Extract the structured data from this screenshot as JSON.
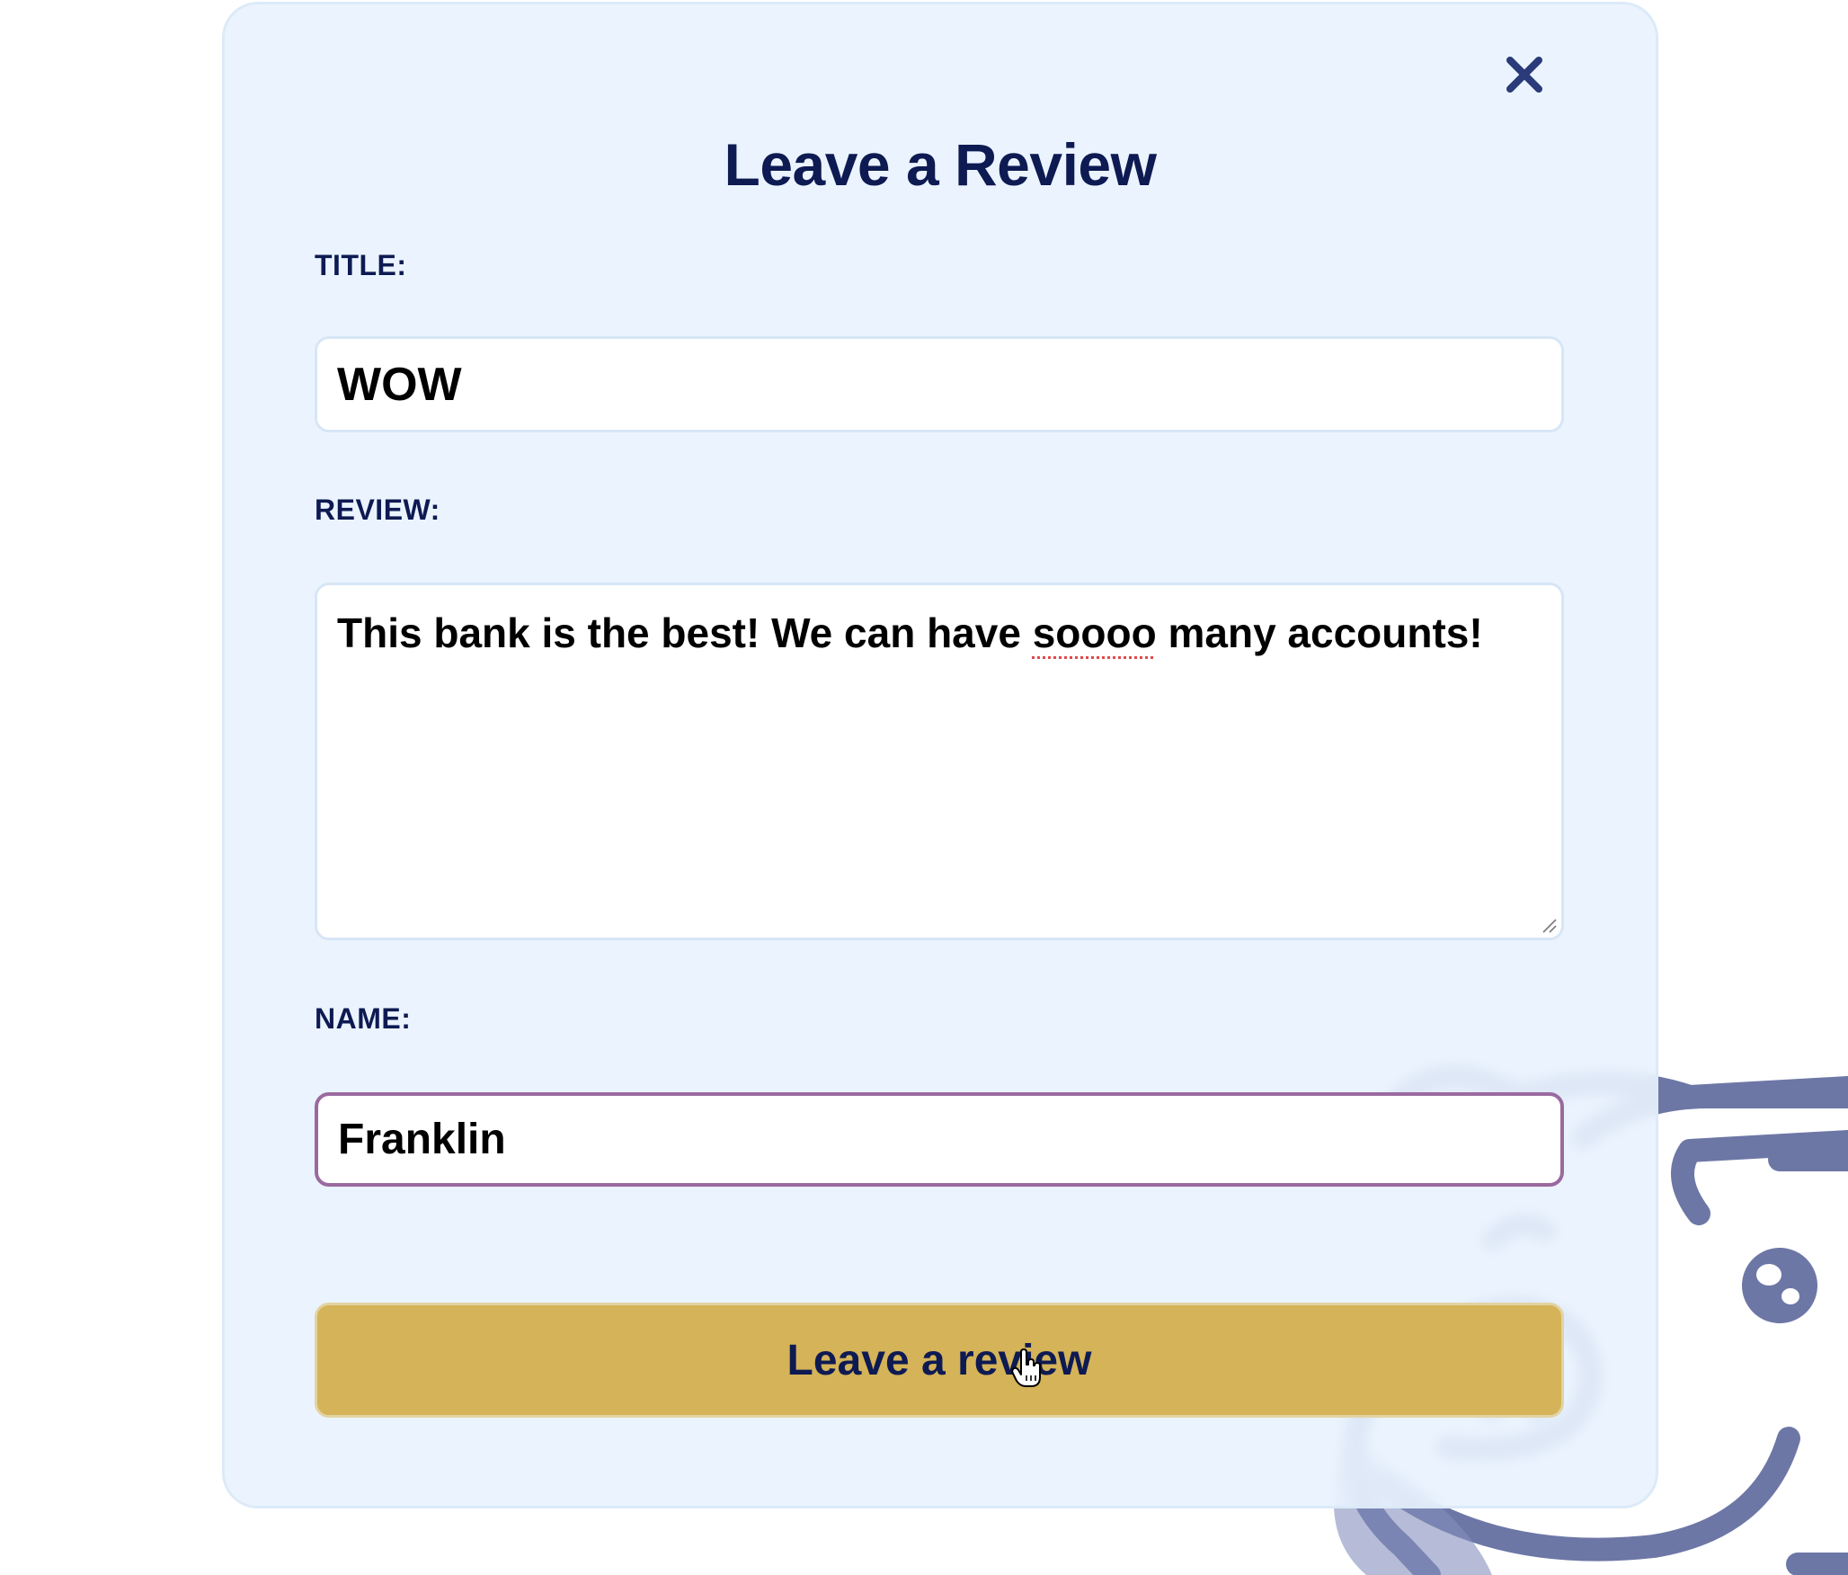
{
  "modal": {
    "title": "Leave a Review",
    "close_icon": "close-icon"
  },
  "form": {
    "title_label": "TITLE:",
    "title_value": "WOW",
    "review_label": "REVIEW:",
    "review_value_before": "This bank is the best! We can have ",
    "review_value_misspelled": "soooo",
    "review_value_after": " many accounts!",
    "name_label": "NAME:",
    "name_value": "Franklin",
    "submit_label": "Leave a review"
  },
  "background": {
    "mascot_icon": "piggy-bank-mascot-icon"
  },
  "colors": {
    "heading": "#0e1a52",
    "modal_bg": "#e9f3fe",
    "button": "#d4b254",
    "focus_border": "#9a6a9f",
    "mascot": "#6d77a6"
  }
}
